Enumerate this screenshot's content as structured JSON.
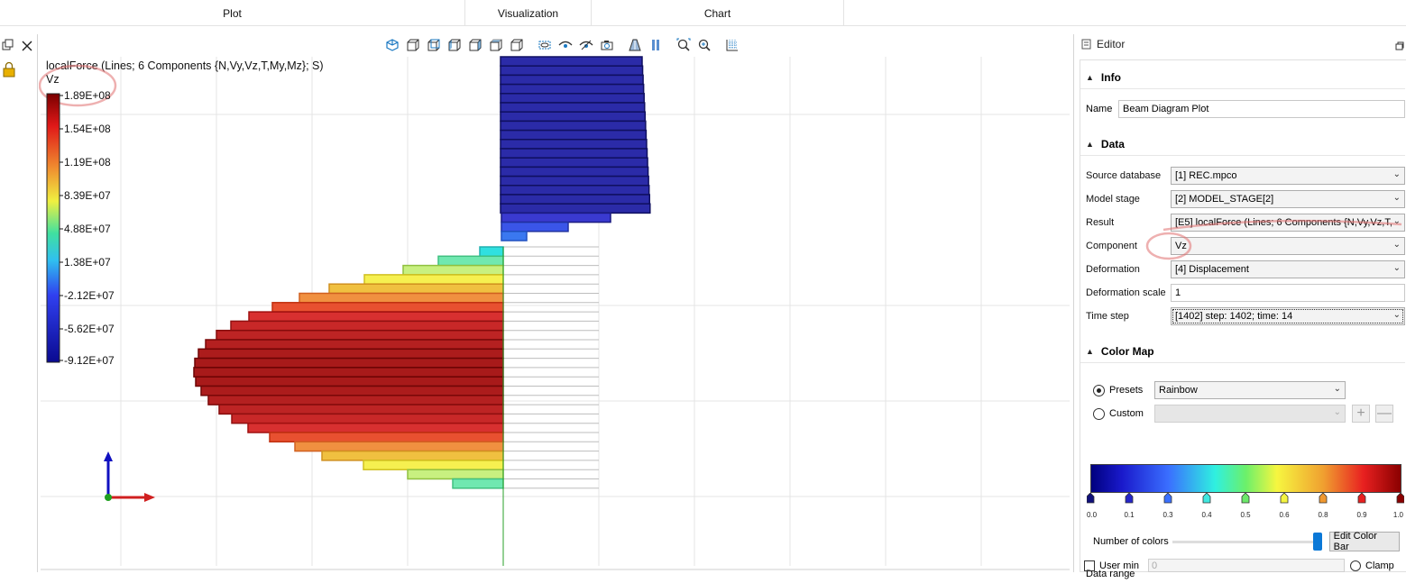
{
  "tabs": [
    "Plot",
    "Visualization",
    "Chart"
  ],
  "plot": {
    "title": "localForce (Lines; 6 Components {N,Vy,Vz,T,My,Mz}; S)",
    "component": "Vz",
    "legend_values": [
      "1.89E+08",
      "1.54E+08",
      "1.19E+08",
      "8.39E+07",
      "4.88E+07",
      "1.38E+07",
      "-2.12E+07",
      "-5.62E+07",
      "-9.12E+07"
    ]
  },
  "editor": {
    "title": "Editor",
    "info_section": "Info",
    "name_label": "Name",
    "name_value": "Beam Diagram Plot",
    "data_section": "Data",
    "fields": [
      {
        "label": "Source database",
        "value": "[1] REC.mpco"
      },
      {
        "label": "Model stage",
        "value": "[2] MODEL_STAGE[2]"
      },
      {
        "label": "Result",
        "value": "[E5] localForce (Lines; 6 Components {N,Vy,Vz,T,"
      },
      {
        "label": "Component",
        "value": "Vz"
      },
      {
        "label": "Deformation",
        "value": "[4] Displacement"
      }
    ],
    "deformation_scale_label": "Deformation scale",
    "deformation_scale_value": "1",
    "time_step_label": "Time step",
    "time_step_value": "[1402] step: 1402; time: 14",
    "colormap_section": "Color Map",
    "presets_label": "Presets",
    "presets_value": "Rainbow",
    "custom_label": "Custom",
    "ticks": [
      "0.0",
      "0.1",
      "0.3",
      "0.4",
      "0.5",
      "0.6",
      "0.8",
      "0.9",
      "1.0"
    ],
    "num_colors_label": "Number of colors",
    "edit_color_bar": "Edit Color Bar",
    "data_range_label": "Data range",
    "user_min_label": "User min",
    "user_min_placeholder": "0",
    "clamp_label": "Clamp"
  },
  "colors": {
    "accent": "#0a78d7",
    "highlight": "#e05050"
  }
}
